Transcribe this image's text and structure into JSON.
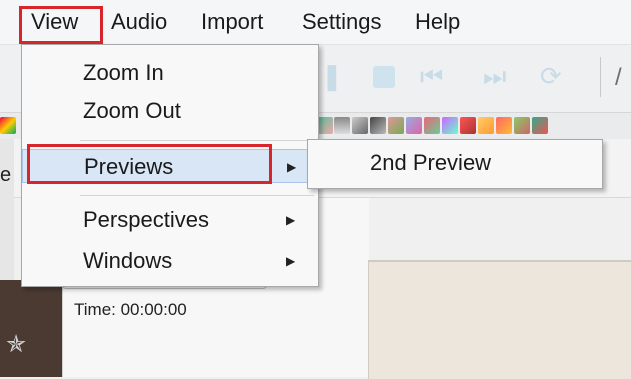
{
  "menubar": {
    "items": [
      "View",
      "Audio",
      "Import",
      "Settings",
      "Help"
    ]
  },
  "view_menu": {
    "items": [
      {
        "label": "Zoom In",
        "has_submenu": false
      },
      {
        "label": "Zoom Out",
        "has_submenu": false
      },
      {
        "label": "Previews",
        "has_submenu": true,
        "highlighted": true
      },
      {
        "label": "Perspectives",
        "has_submenu": true
      },
      {
        "label": "Windows",
        "has_submenu": true
      }
    ],
    "arrow_glyph": "▶"
  },
  "previews_submenu": {
    "items": [
      "2nd Preview"
    ]
  },
  "background": {
    "time_label": "Time: 00:00:00",
    "left_fragment": "e"
  },
  "toolbar": {
    "icons": [
      "pause-icon",
      "stop-icon",
      "skip-back-icon",
      "skip-forward-icon",
      "loop-icon"
    ]
  },
  "colors": {
    "annotation_red": "#d7262b",
    "highlight": "#d8e6f5"
  }
}
